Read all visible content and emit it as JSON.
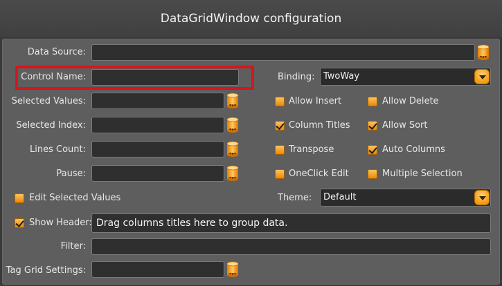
{
  "window": {
    "title": "DataGridWindow configuration"
  },
  "fields": {
    "data_source": {
      "label": "Data Source:",
      "value": ""
    },
    "control_name": {
      "label": "Control Name:",
      "value": ""
    },
    "selected_values": {
      "label": "Selected Values:",
      "value": ""
    },
    "selected_index": {
      "label": "Selected Index:",
      "value": ""
    },
    "lines_count": {
      "label": "Lines Count:",
      "value": ""
    },
    "pause": {
      "label": "Pause:",
      "value": ""
    },
    "filter": {
      "label": "Filter:",
      "value": ""
    },
    "tag_grid_settings": {
      "label": "Tag Grid Settings:",
      "value": ""
    }
  },
  "binding": {
    "label": "Binding:",
    "value": "TwoWay"
  },
  "theme": {
    "label": "Theme:",
    "value": "Default"
  },
  "checkboxes": {
    "allow_insert": {
      "label": "Allow Insert",
      "checked": false
    },
    "allow_delete": {
      "label": "Allow Delete",
      "checked": false
    },
    "column_titles": {
      "label": "Column Titles",
      "checked": true
    },
    "allow_sort": {
      "label": "Allow Sort",
      "checked": true
    },
    "transpose": {
      "label": "Transpose",
      "checked": false
    },
    "auto_columns": {
      "label": "Auto Columns",
      "checked": true
    },
    "oneclick_edit": {
      "label": "OneClick Edit",
      "checked": false
    },
    "multiple_selection": {
      "label": "Multiple Selection",
      "checked": false
    },
    "edit_selected_values": {
      "label": "Edit Selected Values",
      "checked": false
    },
    "show_header": {
      "label": "Show Header:",
      "checked": true
    }
  },
  "show_header_text": "Drag columns titles here to group data.",
  "colors": {
    "accent": "#f39b12",
    "highlight": "#d8151c",
    "panel": "#5e5e5e"
  },
  "icons": {
    "database": "database-icon",
    "dropdown": "chevron-down-icon"
  }
}
